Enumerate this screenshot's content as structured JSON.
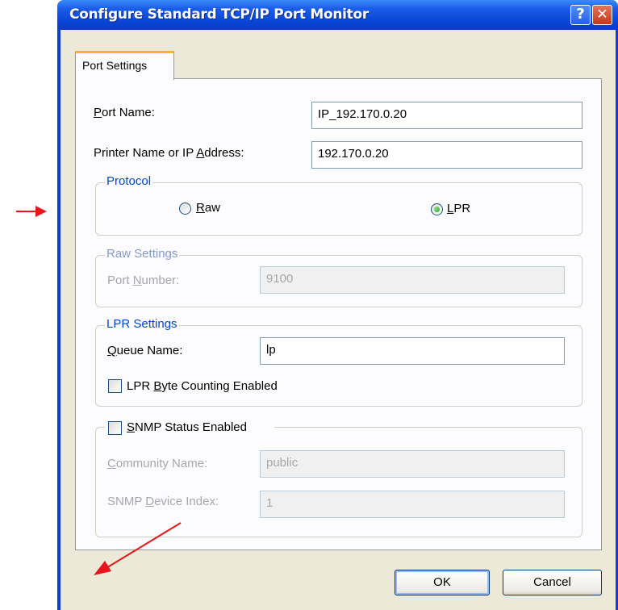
{
  "window": {
    "title": "Configure Standard TCP/IP Port Monitor",
    "help_glyph": "?",
    "close_glyph": "✕"
  },
  "tabs": [
    {
      "label": "Port Settings",
      "active": true
    }
  ],
  "port_name": {
    "label": "Port Name:",
    "value": "IP_192.170.0.20"
  },
  "printer_address": {
    "label": "Printer Name or IP Address:",
    "value": "192.170.0.20"
  },
  "protocol": {
    "title": "Protocol",
    "options": [
      {
        "label": "Raw",
        "selected": false
      },
      {
        "label": "LPR",
        "selected": true
      }
    ]
  },
  "raw_settings": {
    "title": "Raw Settings",
    "port_number_label": "Port Number:",
    "port_number_value": "9100"
  },
  "lpr_settings": {
    "title": "LPR Settings",
    "queue_name_label": "Queue Name:",
    "queue_name_value": "lp",
    "byte_counting_label": "LPR Byte Counting Enabled",
    "byte_counting_checked": false
  },
  "snmp": {
    "enabled_label": "SNMP Status Enabled",
    "enabled_checked": false,
    "community_label": "Community Name:",
    "community_value": "public",
    "device_index_label": "SNMP Device Index:",
    "device_index_value": "1"
  },
  "buttons": {
    "ok": "OK",
    "cancel": "Cancel"
  },
  "colors": {
    "titlebar": "#0a46d6",
    "face": "#ece9d8",
    "tab_accent": "#f8b334",
    "group_title": "#0046d5",
    "annotation_arrow": "#e8161a"
  }
}
